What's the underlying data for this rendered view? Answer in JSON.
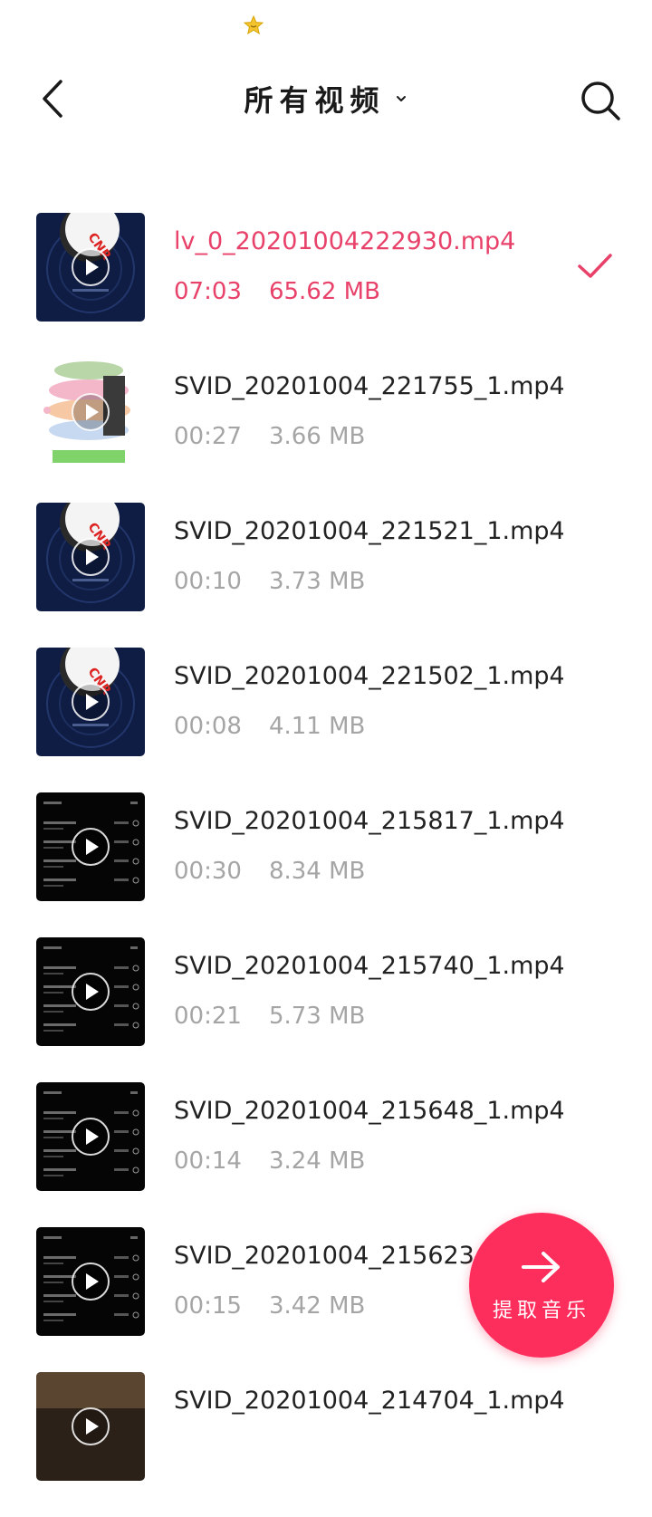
{
  "colors": {
    "accent": "#fd2d5c",
    "selected_text": "#e8426a",
    "meta_text": "#a5a5a5",
    "title_text": "#1a1a1a"
  },
  "status_bar": {
    "icon": "star-badge-icon"
  },
  "header": {
    "back_icon": "chevron-left-icon",
    "title": "所有视频",
    "dropdown_icon": "chevron-down-icon",
    "search_icon": "search-icon"
  },
  "videos": [
    {
      "filename": "lv_0_20201004222930.mp4",
      "duration": "07:03",
      "size": "65.62 MB",
      "selected": true,
      "thumb": "cnr-blue"
    },
    {
      "filename": "SVID_20201004_221755_1.mp4",
      "duration": "00:27",
      "size": "3.66 MB",
      "selected": false,
      "thumb": "macaron"
    },
    {
      "filename": "SVID_20201004_221521_1.mp4",
      "duration": "00:10",
      "size": "3.73 MB",
      "selected": false,
      "thumb": "cnr-blue"
    },
    {
      "filename": "SVID_20201004_221502_1.mp4",
      "duration": "00:08",
      "size": "4.11 MB",
      "selected": false,
      "thumb": "cnr-blue"
    },
    {
      "filename": "SVID_20201004_215817_1.mp4",
      "duration": "00:30",
      "size": "8.34 MB",
      "selected": false,
      "thumb": "dark-list"
    },
    {
      "filename": "SVID_20201004_215740_1.mp4",
      "duration": "00:21",
      "size": "5.73 MB",
      "selected": false,
      "thumb": "dark-list"
    },
    {
      "filename": "SVID_20201004_215648_1.mp4",
      "duration": "00:14",
      "size": "3.24 MB",
      "selected": false,
      "thumb": "dark-list"
    },
    {
      "filename": "SVID_20201004_215623_",
      "duration": "00:15",
      "size": "3.42 MB",
      "selected": false,
      "thumb": "dark-list"
    },
    {
      "filename": "SVID_20201004_214704_1.mp4",
      "duration": "",
      "size": "",
      "selected": false,
      "thumb": "dark-brown"
    }
  ],
  "fab": {
    "icon": "arrow-right-icon",
    "label": "提取音乐"
  }
}
